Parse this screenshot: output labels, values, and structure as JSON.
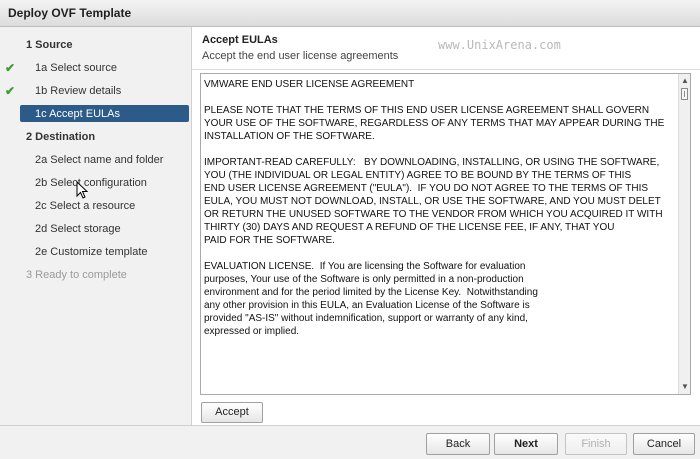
{
  "window": {
    "title": "Deploy OVF Template"
  },
  "steps": [
    {
      "label": "1  Source",
      "kind": "section",
      "state": "normal",
      "check": false
    },
    {
      "label": "1a  Select source",
      "kind": "sub",
      "state": "done",
      "check": true
    },
    {
      "label": "1b  Review details",
      "kind": "sub",
      "state": "done",
      "check": true
    },
    {
      "label": "1c  Accept EULAs",
      "kind": "sub",
      "state": "active",
      "check": false
    },
    {
      "label": "2  Destination",
      "kind": "section",
      "state": "normal",
      "check": false
    },
    {
      "label": "2a  Select name and folder",
      "kind": "sub",
      "state": "normal",
      "check": false
    },
    {
      "label": "2b  Select configuration",
      "kind": "sub",
      "state": "normal",
      "check": false
    },
    {
      "label": "2c  Select a resource",
      "kind": "sub",
      "state": "normal",
      "check": false
    },
    {
      "label": "2d  Select storage",
      "kind": "sub",
      "state": "normal",
      "check": false
    },
    {
      "label": "2e  Customize template",
      "kind": "sub",
      "state": "normal",
      "check": false
    },
    {
      "label": "3  Ready to complete",
      "kind": "section",
      "state": "disabled",
      "check": false
    }
  ],
  "main": {
    "title": "Accept EULAs",
    "subtitle": "Accept the end user license agreements",
    "watermark": "www.UnixArena.com"
  },
  "eula": {
    "lines": [
      "VMWARE END USER LICENSE AGREEMENT",
      "",
      "PLEASE NOTE THAT THE TERMS OF THIS END USER LICENSE AGREEMENT SHALL GOVERN",
      "YOUR USE OF THE SOFTWARE, REGARDLESS OF ANY TERMS THAT MAY APPEAR DURING THE",
      "INSTALLATION OF THE SOFTWARE.",
      "",
      "IMPORTANT-READ CAREFULLY:   BY DOWNLOADING, INSTALLING, OR USING THE SOFTWARE,",
      "YOU (THE INDIVIDUAL OR LEGAL ENTITY) AGREE TO BE BOUND BY THE TERMS OF THIS",
      "END USER LICENSE AGREEMENT (\"EULA\").  IF YOU DO NOT AGREE TO THE TERMS OF THIS",
      "EULA, YOU MUST NOT DOWNLOAD, INSTALL, OR USE THE SOFTWARE, AND YOU MUST DELET",
      "OR RETURN THE UNUSED SOFTWARE TO THE VENDOR FROM WHICH YOU ACQUIRED IT WITH",
      "THIRTY (30) DAYS AND REQUEST A REFUND OF THE LICENSE FEE, IF ANY, THAT YOU",
      "PAID FOR THE SOFTWARE.",
      "",
      "EVALUATION LICENSE.  If You are licensing the Software for evaluation",
      "purposes, Your use of the Software is only permitted in a non-production",
      "environment and for the period limited by the License Key.  Notwithstanding",
      "any other provision in this EULA, an Evaluation License of the Software is",
      "provided \"AS-IS\" without indemnification, support or warranty of any kind,",
      "expressed or implied."
    ]
  },
  "buttons": {
    "accept": "Accept",
    "back": "Back",
    "next": "Next",
    "finish": "Finish",
    "cancel": "Cancel"
  },
  "icons": {
    "check": "checkmark-icon",
    "scroll_up": "scroll-up-icon",
    "scroll_down": "scroll-down-icon",
    "cursor": "mouse-cursor-icon"
  },
  "colors": {
    "active_step_bg": "#2c5b8a",
    "check": "#3e9d32"
  }
}
